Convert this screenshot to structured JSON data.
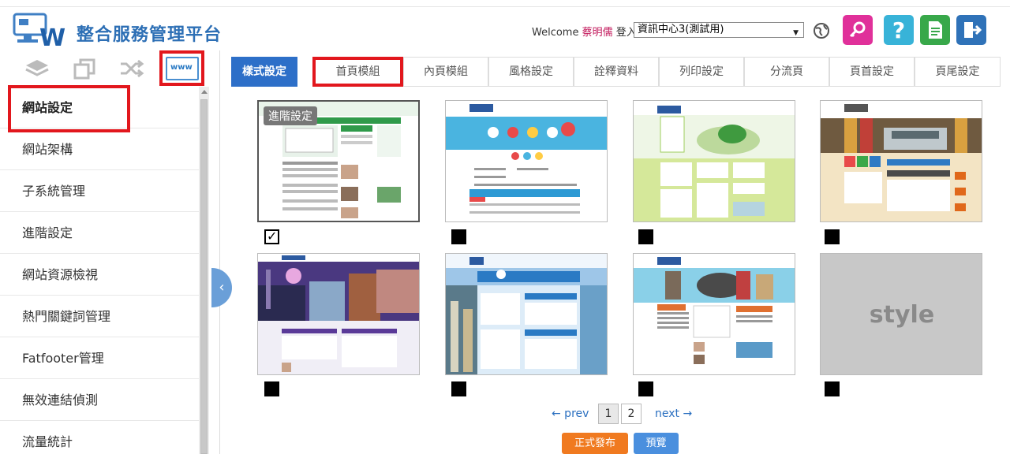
{
  "header": {
    "brand": "整合服務管理平台",
    "welcome_prefix": "Welcome",
    "user_name": "蔡明儒",
    "login_text": "登入",
    "unit_selected": "資訊中心3(測試用)"
  },
  "sidebar": {
    "items": [
      {
        "label": "網站設定"
      },
      {
        "label": "網站架構"
      },
      {
        "label": "子系統管理"
      },
      {
        "label": "進階設定"
      },
      {
        "label": "網站資源檢視"
      },
      {
        "label": "熱門關鍵詞管理"
      },
      {
        "label": "Fatfooter管理"
      },
      {
        "label": "無效連結偵測"
      },
      {
        "label": "流量統計"
      }
    ]
  },
  "tabs": [
    {
      "label": "樣式設定"
    },
    {
      "label": "首頁模組"
    },
    {
      "label": "內頁模組"
    },
    {
      "label": "風格設定"
    },
    {
      "label": "詮釋資料"
    },
    {
      "label": "列印設定"
    },
    {
      "label": "分流頁"
    },
    {
      "label": "頁首設定"
    },
    {
      "label": "頁尾設定"
    }
  ],
  "gallery": {
    "advanced_badge": "進階設定",
    "placeholder_text": "style"
  },
  "pagination": {
    "prev": "← prev",
    "pages": [
      "1",
      "2"
    ],
    "next": "next →"
  },
  "actions": {
    "publish": "正式發布",
    "preview": "預覽"
  },
  "colors": {
    "accent": "#2d6fc8",
    "highlight": "#e2171d",
    "publish": "#f07a20"
  }
}
